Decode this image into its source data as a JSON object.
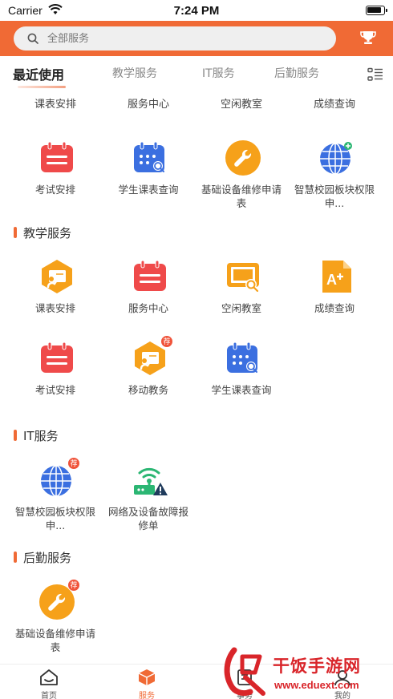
{
  "status_bar": {
    "carrier": "Carrier",
    "time": "7:24 PM"
  },
  "header": {
    "search_placeholder": "全部服务"
  },
  "tabs": [
    {
      "label": "最近使用",
      "active": true
    },
    {
      "label": "教学服务"
    },
    {
      "label": "IT服务"
    },
    {
      "label": "后勤服务"
    }
  ],
  "recent": {
    "partial_row": [
      "课表安排",
      "服务中心",
      "空闲教室",
      "成绩查询"
    ],
    "items": [
      {
        "label": "考试安排",
        "icon": "calendar-icon"
      },
      {
        "label": "学生课表查询",
        "icon": "schedule-search-icon"
      },
      {
        "label": "基础设备维修申请表",
        "icon": "wrench-icon"
      },
      {
        "label": "智慧校园板块权限申...",
        "icon": "globe-icon"
      }
    ]
  },
  "teaching": {
    "title": "教学服务",
    "items": [
      {
        "label": "课表安排",
        "icon": "teacher-board-icon"
      },
      {
        "label": "服务中心",
        "icon": "calendar-icon"
      },
      {
        "label": "空闲教室",
        "icon": "classroom-search-icon"
      },
      {
        "label": "成绩查询",
        "icon": "grade-icon"
      },
      {
        "label": "考试安排",
        "icon": "calendar-icon"
      },
      {
        "label": "移动教务",
        "icon": "teacher-board-icon",
        "badge": "荐"
      },
      {
        "label": "学生课表查询",
        "icon": "schedule-search-icon"
      }
    ]
  },
  "it": {
    "title": "IT服务",
    "items": [
      {
        "label": "智慧校园板块权限申...",
        "icon": "globe-icon",
        "badge": "荐"
      },
      {
        "label": "网络及设备故障报修单",
        "icon": "network-alert-icon"
      }
    ]
  },
  "logistics": {
    "title": "后勤服务",
    "items": [
      {
        "label": "基础设备维修申请表",
        "icon": "wrench-icon",
        "badge": "荐"
      }
    ]
  },
  "bottom_nav": [
    {
      "label": "首页"
    },
    {
      "label": "服务",
      "active": true
    },
    {
      "label": "事务"
    },
    {
      "label": "我的"
    }
  ],
  "watermark": {
    "text": "干饭手游网",
    "url": "www.eduext.com"
  },
  "colors": {
    "accent": "#f06a35",
    "red_icon": "#ef4a4a",
    "blue_icon": "#3b6fe0",
    "orange_icon": "#f6a11a"
  }
}
